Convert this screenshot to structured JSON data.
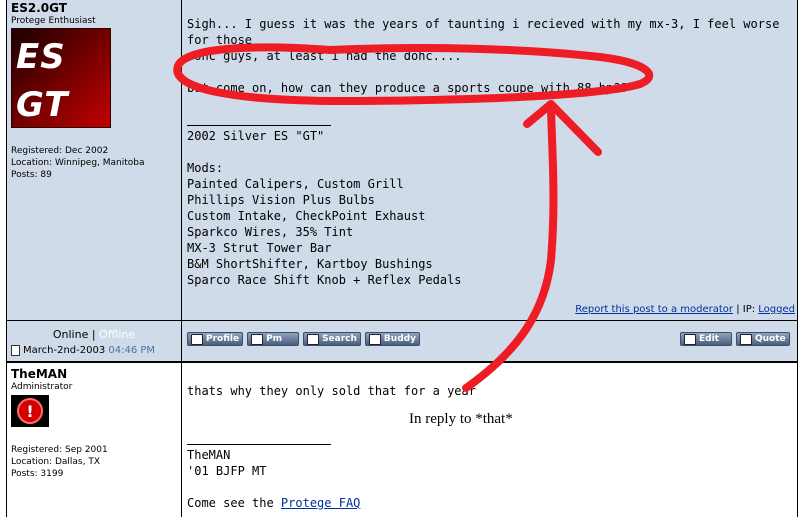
{
  "post1": {
    "username": "ES2.0GT",
    "user_title": "Protege Enthusiast",
    "avatar_line1": "ES",
    "avatar_line2": "GT",
    "registered": "Registered: Dec 2002",
    "location": "Location: Winnipeg, Manitoba",
    "posts": "Posts: 89",
    "body_line1": "Sigh... I guess it was the years of taunting i recieved with my mx-3, I feel worse for those",
    "body_line2": "sohc guys, at least i had the dohc....",
    "body_line3": "but come on, how can they produce a sports coupe with 88 hp??",
    "signature": [
      "2002 Silver ES \"GT\"",
      "",
      "Mods:",
      "Painted Calipers, Custom Grill",
      "Phillips Vision Plus Bulbs",
      "Custom Intake, CheckPoint Exhaust",
      "Sparkco Wires, 35% Tint",
      "MX-3 Strut Tower Bar",
      "B&M ShortShifter, Kartboy Bushings",
      "Sparco Race Shift Knob + Reflex Pedals"
    ],
    "report_link": "Report this post to a moderator",
    "ip_label": " | IP: ",
    "ip_value": "Logged"
  },
  "footer1": {
    "online": "Online",
    "sep": " | ",
    "offline": "Offline",
    "date": "March-2nd-2003",
    "time": "04:46 PM",
    "buttons": [
      "Profile",
      "Pm",
      "Search",
      "Buddy"
    ],
    "edit": "Edit",
    "quote": "Quote"
  },
  "post2": {
    "username": "TheMAN",
    "user_title": "Administrator",
    "avatar_symbol": "!",
    "registered": "Registered: Sep 2001",
    "location": "Location: Dallas, TX",
    "posts": "Posts: 3199",
    "body": "thats why they only sold that for a year",
    "annotation": "In reply to *that*",
    "sig_line1": "TheMAN",
    "sig_line2": "'01 BJFP MT",
    "faq_prefix": "Come see the ",
    "faq_link": "Protege FAQ"
  },
  "colors": {
    "panel": "#d0dbe9",
    "annotation_red": "#ee1c24",
    "link": "#00309c",
    "offline_text": "#ffffff",
    "time_text": "#4f6fa8"
  }
}
